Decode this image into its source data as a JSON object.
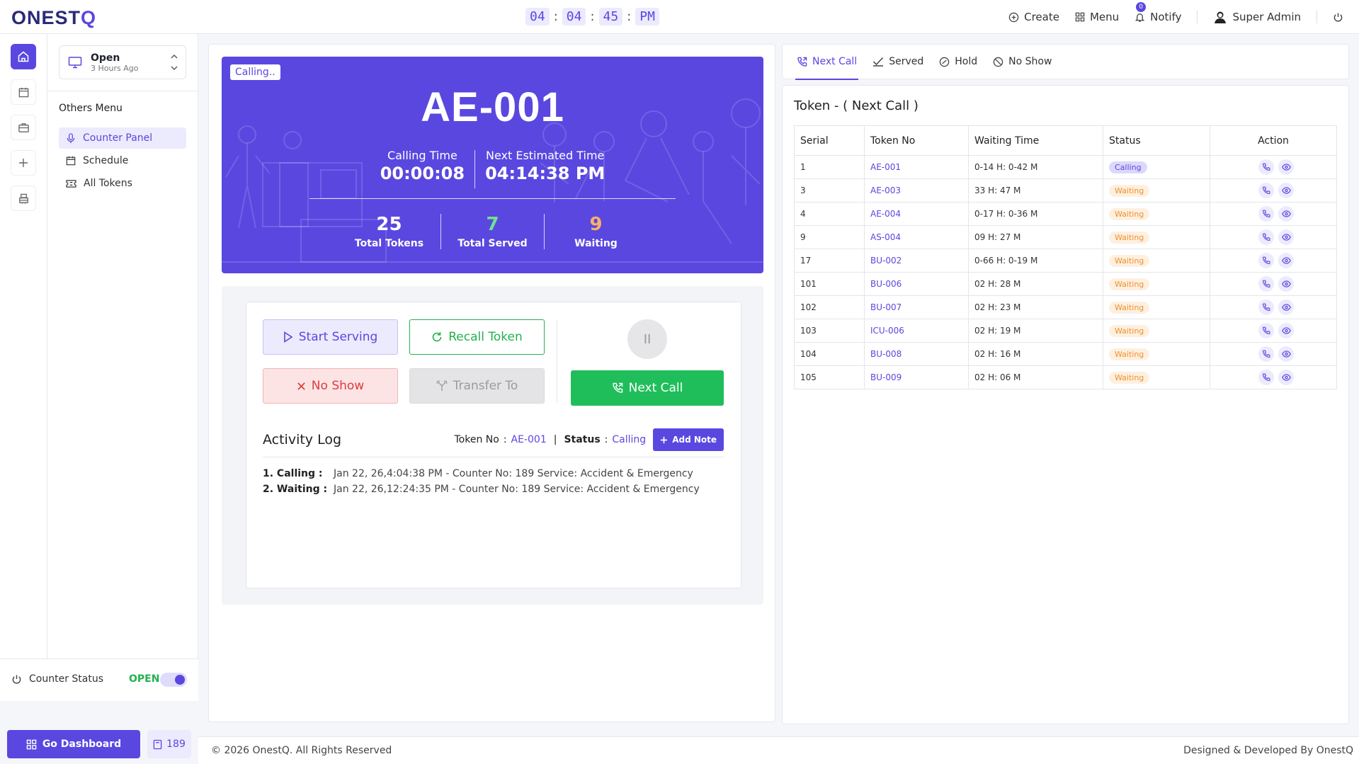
{
  "brand": {
    "logo_a": "ONEST",
    "logo_b": "Q"
  },
  "clock": {
    "hh": "04",
    "mm": "04",
    "ss": "45",
    "ampm": "PM"
  },
  "topnav": {
    "create": "Create",
    "menu": "Menu",
    "notify": "Notify",
    "notify_count": "0",
    "user": "Super Admin"
  },
  "sidebar": {
    "status_title": "Open",
    "status_sub": "3 Hours Ago",
    "others_title": "Others Menu",
    "items": [
      {
        "label": "Counter Panel"
      },
      {
        "label": "Schedule"
      },
      {
        "label": "All Tokens"
      }
    ],
    "counter_status_label": "Counter Status",
    "counter_status_value": "OPEN",
    "dashboard_button": "Go Dashboard",
    "counter_number": "189"
  },
  "hero": {
    "tag": "Calling..",
    "token": "AE-001",
    "calling_time_label": "Calling Time",
    "calling_time": "00:00:08",
    "next_est_label": "Next Estimated Time",
    "next_est": "04:14:38 PM",
    "total_tokens": "25",
    "total_tokens_label": "Total Tokens",
    "total_served": "7",
    "total_served_label": "Total Served",
    "waiting": "9",
    "waiting_label": "Waiting"
  },
  "colors": {
    "primary": "#5a47e0",
    "green": "#23b14d",
    "orange": "#f0a050",
    "red": "#e0393e"
  },
  "actions": {
    "start": "Start Serving",
    "recall": "Recall Token",
    "noshow": "No Show",
    "transfer": "Transfer To",
    "pause": "II",
    "next": "Next Call"
  },
  "activity": {
    "title": "Activity Log",
    "token_label": "Token No",
    "token_value": "AE-001",
    "status_label": "Status",
    "status_value": "Calling",
    "add_note": "Add Note",
    "entries": [
      {
        "key": "1. Calling :",
        "text": "Jan 22, 26,4:04:38 PM - Counter No: 189 Service: Accident & Emergency"
      },
      {
        "key": "2. Waiting :",
        "text": "Jan 22, 26,12:24:35 PM - Counter No: 189 Service: Accident & Emergency"
      }
    ]
  },
  "tabs": [
    {
      "label": "Next Call"
    },
    {
      "label": "Served"
    },
    {
      "label": "Hold"
    },
    {
      "label": "No Show"
    }
  ],
  "queue": {
    "title": "Token - ( Next Call )",
    "columns": [
      "Serial",
      "Token No",
      "Waiting Time",
      "Status",
      "Action"
    ],
    "rows": [
      {
        "serial": "1",
        "token": "AE-001",
        "wait": "0-14 H: 0-42 M",
        "status": "Calling"
      },
      {
        "serial": "3",
        "token": "AE-003",
        "wait": "33 H: 47 M",
        "status": "Waiting"
      },
      {
        "serial": "4",
        "token": "AE-004",
        "wait": "0-17 H: 0-36 M",
        "status": "Waiting"
      },
      {
        "serial": "9",
        "token": "AS-004",
        "wait": "09 H: 27 M",
        "status": "Waiting"
      },
      {
        "serial": "17",
        "token": "BU-002",
        "wait": "0-66 H: 0-19 M",
        "status": "Waiting"
      },
      {
        "serial": "101",
        "token": "BU-006",
        "wait": "02 H: 28 M",
        "status": "Waiting"
      },
      {
        "serial": "102",
        "token": "BU-007",
        "wait": "02 H: 23 M",
        "status": "Waiting"
      },
      {
        "serial": "103",
        "token": "ICU-006",
        "wait": "02 H: 19 M",
        "status": "Waiting"
      },
      {
        "serial": "104",
        "token": "BU-008",
        "wait": "02 H: 16 M",
        "status": "Waiting"
      },
      {
        "serial": "105",
        "token": "BU-009",
        "wait": "02 H: 06 M",
        "status": "Waiting"
      }
    ]
  },
  "footer": {
    "left": "© 2026 OnestQ. All Rights Reserved",
    "right": "Designed & Developed By OnestQ"
  }
}
